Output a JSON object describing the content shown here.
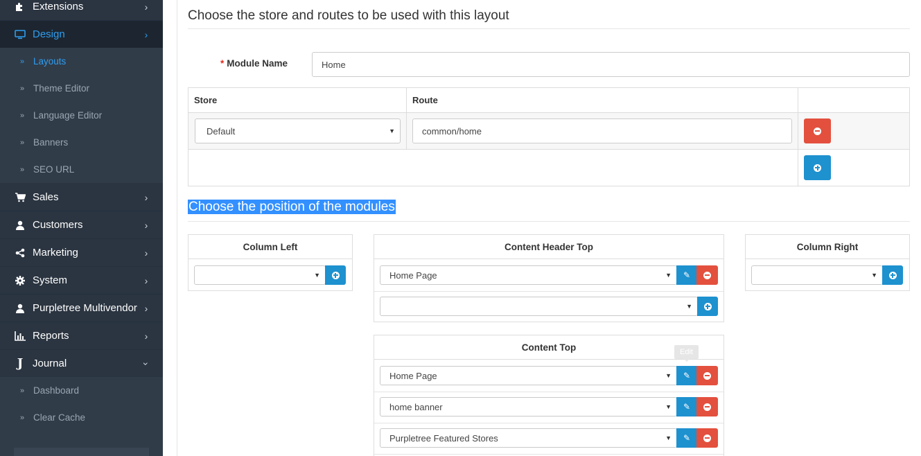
{
  "sidebar": {
    "items": [
      {
        "label": "Extensions",
        "icon": "puzzle-icon"
      },
      {
        "label": "Design",
        "icon": "monitor-icon",
        "active": true
      },
      {
        "label": "Sales",
        "icon": "cart-icon"
      },
      {
        "label": "Customers",
        "icon": "user-icon"
      },
      {
        "label": "Marketing",
        "icon": "share-icon"
      },
      {
        "label": "System",
        "icon": "gear-icon"
      },
      {
        "label": "Purpletree Multivendor",
        "icon": "user-icon"
      },
      {
        "label": "Reports",
        "icon": "bar-chart-icon"
      },
      {
        "label": "Journal",
        "icon": "journal-j-icon"
      }
    ],
    "design_sub": [
      {
        "label": "Layouts",
        "active": true
      },
      {
        "label": "Theme Editor"
      },
      {
        "label": "Language Editor"
      },
      {
        "label": "Banners"
      },
      {
        "label": "SEO URL"
      }
    ],
    "journal_sub": [
      {
        "label": "Dashboard"
      },
      {
        "label": "Clear Cache"
      }
    ]
  },
  "store_section": {
    "heading": "Choose the store and routes to be used with this layout",
    "module_name_label": "Module Name",
    "module_name_value": "Home",
    "table": {
      "headers": [
        "Store",
        "Route"
      ],
      "rows": [
        {
          "store": "Default",
          "route": "common/home"
        }
      ]
    }
  },
  "position_section": {
    "heading": "Choose the position of the modules",
    "column_left": {
      "title": "Column Left",
      "selected": ""
    },
    "column_right": {
      "title": "Column Right",
      "selected": ""
    },
    "content_header_top": {
      "title": "Content Header Top",
      "modules": [
        "Home Page"
      ],
      "new_selected": ""
    },
    "content_top": {
      "title": "Content Top",
      "modules": [
        "Home Page",
        "home banner",
        "Purpletree Featured Stores"
      ]
    }
  },
  "tooltip": "Edit",
  "colors": {
    "sidebar_bg": "#2b3541",
    "accent": "#2e9ef0",
    "btn_blue": "#1e91cf",
    "btn_red": "#e3503e"
  }
}
